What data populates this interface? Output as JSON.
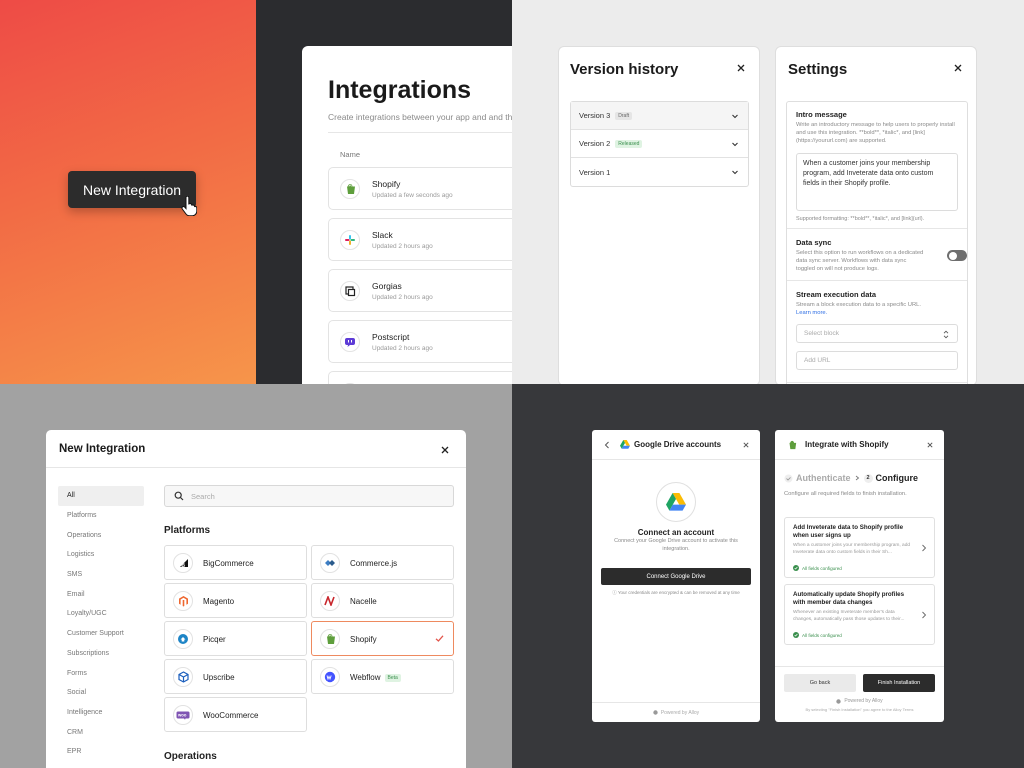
{
  "cta": {
    "label": "New Integration"
  },
  "integrations": {
    "title": "Integrations",
    "subtitle": "Create integrations between your app and and thir",
    "column_name": "Name",
    "rows": [
      {
        "name": "Shopify",
        "updated": "Updated a few seconds ago",
        "icon": "shopify-icon"
      },
      {
        "name": "Slack",
        "updated": "Updated 2 hours ago",
        "icon": "slack-icon"
      },
      {
        "name": "Gorgias",
        "updated": "Updated 2 hours ago",
        "icon": "gorgias-icon"
      },
      {
        "name": "Postscript",
        "updated": "Updated 2 hours ago",
        "icon": "postscript-icon"
      }
    ]
  },
  "version_history": {
    "title": "Version history",
    "items": [
      {
        "label": "Version 3",
        "badge": "Draft"
      },
      {
        "label": "Version 2",
        "badge": "Released"
      },
      {
        "label": "Version 1",
        "badge": ""
      }
    ]
  },
  "settings": {
    "title": "Settings",
    "intro": {
      "title": "Intro message",
      "desc": "Write an introductory message to help users to properly install and use this integration. **bold**, *italic*, and [link](https://yoururl.com) are supported.",
      "value": "When a customer joins your membership program, add Inveterate data onto custom fields in their Shopify profile.",
      "hint": "Supported formatting: **bold**, *italic*, and [link](url)."
    },
    "data_sync": {
      "title": "Data sync",
      "desc": "Select this option to run workflows on a dedicated data sync server. Workflows with data sync toggled on will not produce logs."
    },
    "stream": {
      "title": "Stream execution data",
      "desc": "Stream a block execution data to a specific URL.",
      "learn_more": "Learn more.",
      "select_placeholder": "Select block",
      "url_placeholder": "Add URL"
    }
  },
  "new_integration": {
    "title": "New Integration",
    "categories": [
      "All",
      "Platforms",
      "Operations",
      "Logistics",
      "SMS",
      "Email",
      "Loyalty/UGC",
      "Customer Support",
      "Subscriptions",
      "Forms",
      "Social",
      "Intelligence",
      "CRM",
      "EPR"
    ],
    "search_placeholder": "Search",
    "section_platforms": "Platforms",
    "section_operations": "Operations",
    "platforms": [
      {
        "name": "BigCommerce",
        "icon": "bigcommerce-icon",
        "badge": "",
        "selected": false
      },
      {
        "name": "Commerce.js",
        "icon": "commercejs-icon",
        "badge": "",
        "selected": false
      },
      {
        "name": "Magento",
        "icon": "magento-icon",
        "badge": "",
        "selected": false
      },
      {
        "name": "Nacelle",
        "icon": "nacelle-icon",
        "badge": "",
        "selected": false
      },
      {
        "name": "Picqer",
        "icon": "picqer-icon",
        "badge": "",
        "selected": false
      },
      {
        "name": "Shopify",
        "icon": "shopify-icon",
        "badge": "",
        "selected": true
      },
      {
        "name": "Upscribe",
        "icon": "upscribe-icon",
        "badge": "",
        "selected": false
      },
      {
        "name": "Webflow",
        "icon": "webflow-icon",
        "badge": "Beta",
        "selected": false
      },
      {
        "name": "WooCommerce",
        "icon": "woocommerce-icon",
        "badge": "",
        "selected": false
      }
    ]
  },
  "google_drive": {
    "title": "Google Drive accounts",
    "connect_title": "Connect an account",
    "connect_desc": "Connect your Google Drive account to activate this integration.",
    "button": "Connect Google Drive",
    "note": "Your credentials are encrypted & can be removed at any time",
    "powered": "Powered by Alloy"
  },
  "shopify_install": {
    "title": "Integrate with Shopify",
    "step1": "Authenticate",
    "step2_num": "2",
    "step2": "Configure",
    "subtitle": "Configure all required fields to finish installation.",
    "cards": [
      {
        "title": "Add Inveterate data to Shopify profile when user signs up",
        "desc": "When a customer joins your membership program, add Inveterate data onto custom fields in their Sh...",
        "status": "All fields configured"
      },
      {
        "title": "Automatically update Shopify profiles with member data changes",
        "desc": "Whenever an existing Inveterate member's data changes, automatically pass those updates to their...",
        "status": "All fields configured"
      }
    ],
    "back": "Go back",
    "finish": "Finish Installation",
    "powered": "Powered by Alloy",
    "terms": "By selecting \"Finish Installation\" you agree to the Alloy Terms"
  },
  "colors": {
    "accent_green": "#3a8f4d",
    "selected_border": "#ee8a5f",
    "dark_button": "#2c2c2c",
    "link_blue": "#2f6fe4"
  }
}
